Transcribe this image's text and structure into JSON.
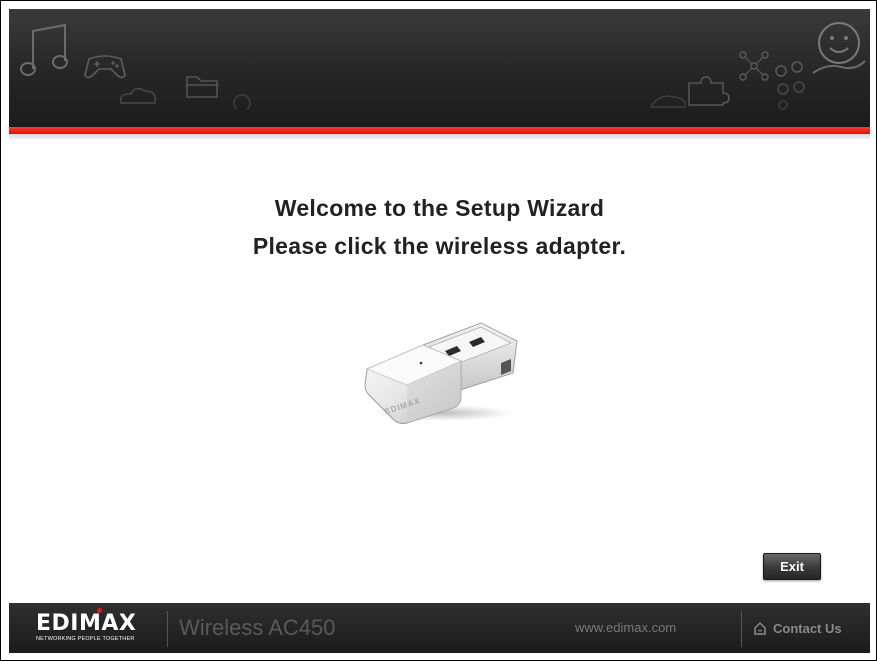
{
  "header": {
    "background_icons": [
      "music-note-icon",
      "gamepad-icon",
      "folder-icon",
      "cloud-icon",
      "puzzle-icon",
      "network-icon",
      "smiley-hand-icon"
    ]
  },
  "main": {
    "welcome_line1": "Welcome to the Setup Wizard",
    "welcome_line2": "Please click the wireless adapter.",
    "adapter_brand": "EDIMAX",
    "exit_label": "Exit"
  },
  "footer": {
    "brand_name": "EDIMAX",
    "brand_tagline": "NETWORKING PEOPLE TOGETHER",
    "product_name": "Wireless AC450",
    "website": "www.edimax.com",
    "contact_label": "Contact Us"
  },
  "colors": {
    "header_bg": "#262626",
    "accent_red": "#e30f0f",
    "footer_bg": "#1f1f1f",
    "button_bg": "#3c3c3c"
  }
}
